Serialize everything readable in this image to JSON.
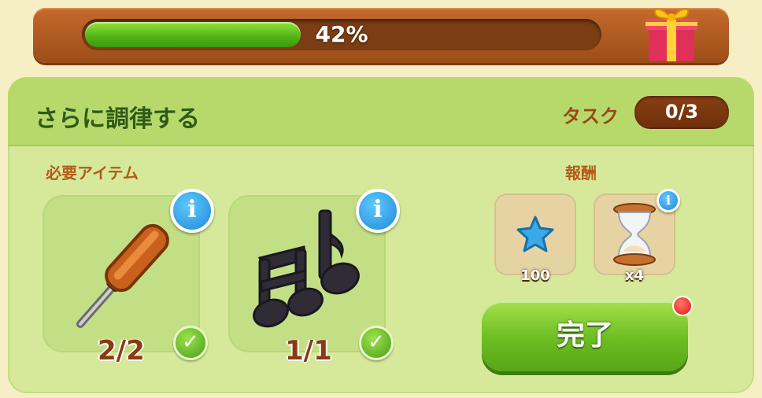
{
  "progress": {
    "percent": 42,
    "label": "42%"
  },
  "panel": {
    "title": "さらに調律する",
    "task_label": "タスク",
    "task_count": "0/3",
    "required_label": "必要アイテム",
    "reward_label": "報酬",
    "items": [
      {
        "name": "screwdriver-icon",
        "count": "2/2",
        "complete": true
      },
      {
        "name": "music-notes-icon",
        "count": "1/1",
        "complete": true
      }
    ],
    "rewards": [
      {
        "name": "blue-star-icon",
        "value": "100"
      },
      {
        "name": "hourglass-icon",
        "value": "x4"
      }
    ],
    "complete_label": "完了"
  },
  "icons": {
    "info": "i",
    "check": "✓"
  },
  "colors": {
    "progress_fill": "#4fb414",
    "frame": "#b45f22",
    "panel": "#d6e99a",
    "button": "#6cbc22"
  }
}
